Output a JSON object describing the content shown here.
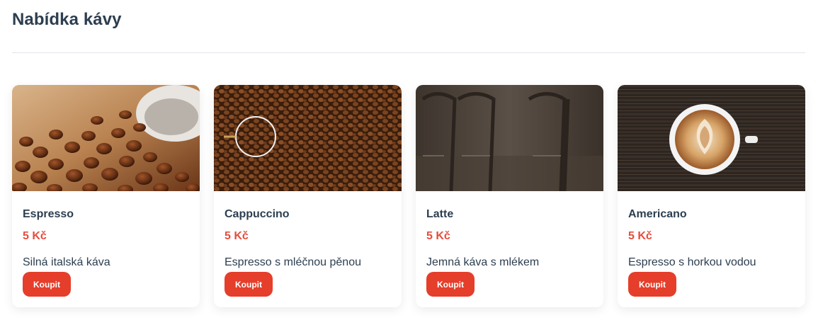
{
  "page": {
    "title": "Nabídka kávy"
  },
  "products": [
    {
      "name": "Espresso",
      "price": "5 Kč",
      "description": "Silná italská káva",
      "button": "Koupit",
      "image": "coffee-beans-spilled-cup"
    },
    {
      "name": "Cappuccino",
      "price": "5 Kč",
      "description": "Espresso s mléčnou pěnou",
      "button": "Koupit",
      "image": "coffee-beans-magnifier"
    },
    {
      "name": "Latte",
      "price": "5 Kč",
      "description": "Jemná káva s mlékem",
      "button": "Koupit",
      "image": "bar-stools"
    },
    {
      "name": "Americano",
      "price": "5 Kč",
      "description": "Espresso s horkou vodou",
      "button": "Koupit",
      "image": "latte-art-cup"
    }
  ],
  "colors": {
    "title": "#2c3e50",
    "price": "#e74c3c",
    "button": "#e53e2a"
  }
}
